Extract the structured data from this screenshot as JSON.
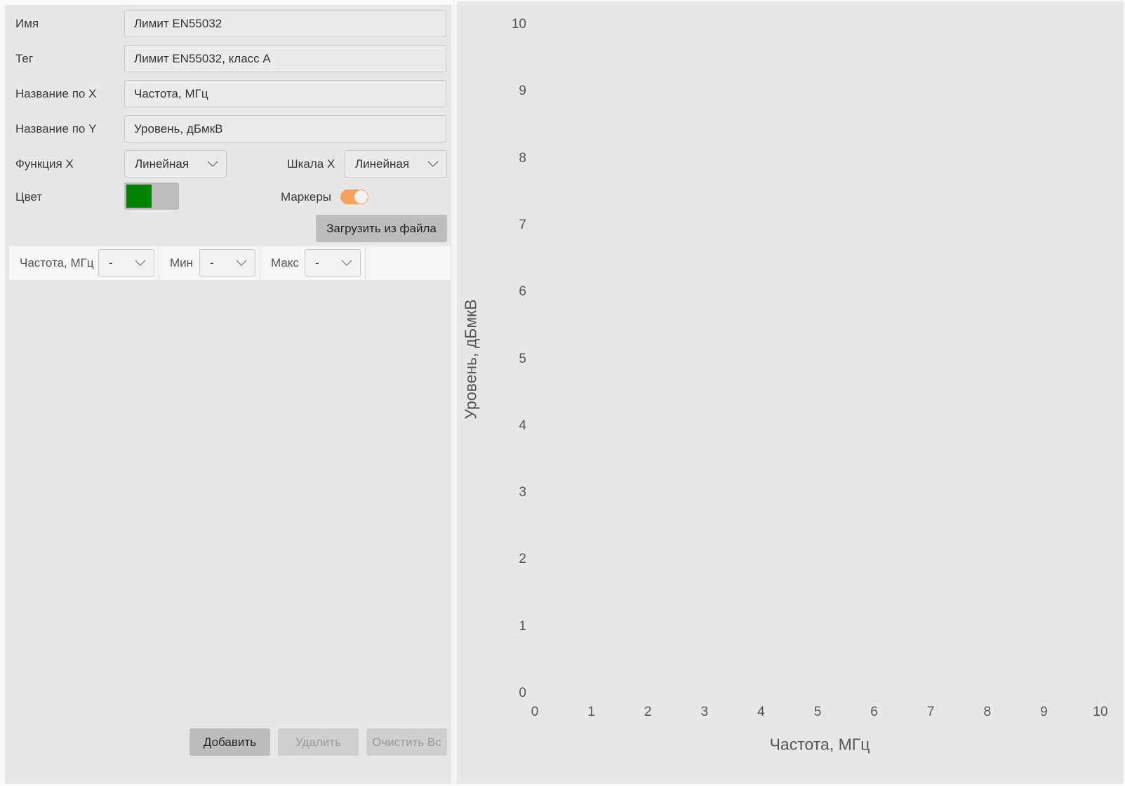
{
  "form": {
    "name_label": "Имя",
    "name_value": "Лимит EN55032",
    "tag_label": "Тег",
    "tag_value": "Лимит EN55032, класс А",
    "xname_label": "Название по X",
    "xname_value": "Частота, МГц",
    "yname_label": "Название по Y",
    "yname_value": "Уровень, дБмкВ",
    "func_x_label": "Функция X",
    "func_x_value": "Линейная",
    "scale_x_label": "Шкала X",
    "scale_x_value": "Линейная",
    "color_label": "Цвет",
    "color_value": "#008000",
    "markers_label": "Маркеры",
    "markers_on": true,
    "markers_color": "#f7a15d",
    "load_button": "Загрузить из файла"
  },
  "table": {
    "columns": [
      {
        "label": "Частота, МГц",
        "value": "-"
      },
      {
        "label": "Мин",
        "value": "-"
      },
      {
        "label": "Макс",
        "value": "-"
      }
    ]
  },
  "actions": {
    "add": "Добавить",
    "delete": "Удалить",
    "clear": "Очистить Вс"
  },
  "chart_data": {
    "type": "line",
    "series": [],
    "xlabel": "Частота, МГц",
    "ylabel": "Уровень, дБмкВ",
    "xlim": [
      0,
      10
    ],
    "ylim": [
      0,
      10
    ],
    "x_ticks": [
      "0",
      "1",
      "2",
      "3",
      "4",
      "5",
      "6",
      "7",
      "8",
      "9",
      "10"
    ],
    "y_ticks": [
      "0",
      "1",
      "2",
      "3",
      "4",
      "5",
      "6",
      "7",
      "8",
      "9",
      "10"
    ],
    "grid": false
  }
}
